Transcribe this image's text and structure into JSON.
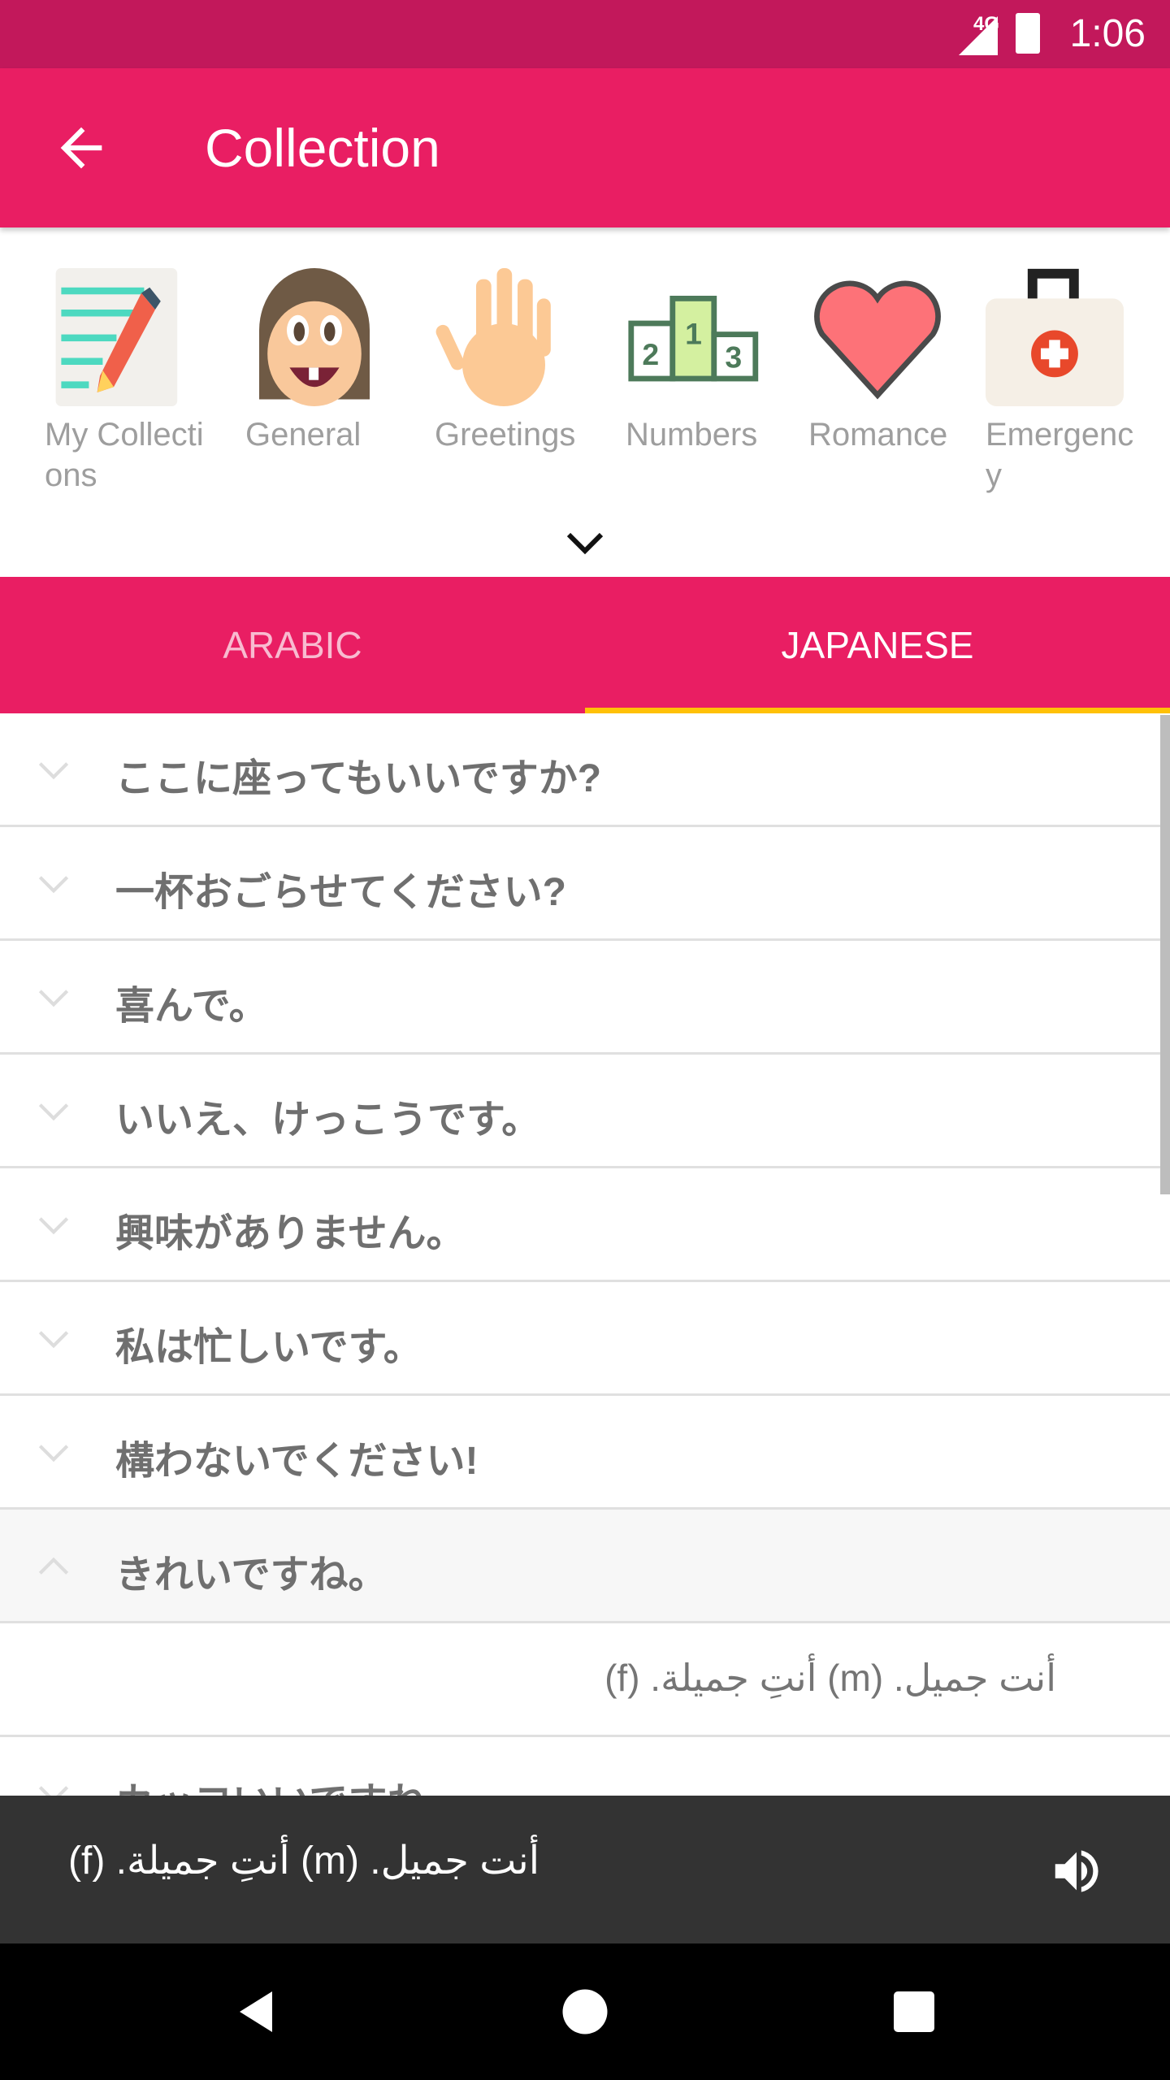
{
  "status_bar": {
    "network": "4G",
    "time": "1:06"
  },
  "app_bar": {
    "title": "Collection"
  },
  "categories": [
    {
      "label": "My Collections",
      "icon": "notebook-pencil-icon"
    },
    {
      "label": "General",
      "icon": "girl-face-icon"
    },
    {
      "label": "Greetings",
      "icon": "hand-wave-icon"
    },
    {
      "label": "Numbers",
      "icon": "podium-icon"
    },
    {
      "label": "Romance",
      "icon": "heart-icon"
    },
    {
      "label": "Emergency",
      "icon": "first-aid-kit-icon"
    }
  ],
  "tabs": [
    {
      "label": "ARABIC",
      "selected": false
    },
    {
      "label": "JAPANESE",
      "selected": true
    }
  ],
  "colors": {
    "primary": "#E91E63",
    "primary_dark": "#C2185B",
    "indicator": "#FFC107"
  },
  "phrases": [
    "ここに座ってもいいですか?",
    "一杯おごらせてください?",
    "喜んで。",
    "いいえ、けっこうです。",
    "興味がありません。",
    "私は忙しいです。",
    "構わないでください!",
    "きれいですね。",
    "カッコいいですね。"
  ],
  "expanded": {
    "index": 7,
    "translation": "أنت جميل. (m)  أنتِ جميلة. (f)"
  },
  "player": {
    "text": "أنت جميل. (m)  أنتِ جميلة. (f)"
  }
}
